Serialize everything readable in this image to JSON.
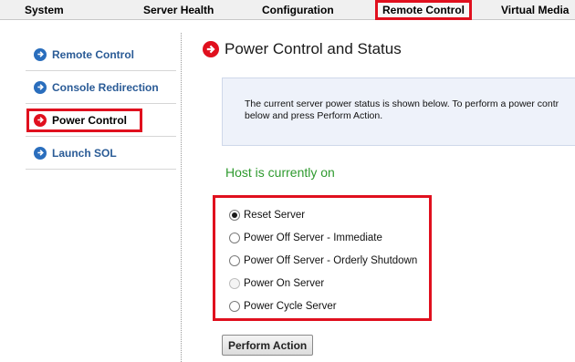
{
  "topnav": {
    "tabs": [
      {
        "label": "System"
      },
      {
        "label": "Server Health"
      },
      {
        "label": "Configuration"
      },
      {
        "label": "Remote Control"
      },
      {
        "label": "Virtual Media"
      }
    ],
    "active": "Remote Control"
  },
  "sidebar": {
    "items": [
      {
        "label": "Remote Control",
        "icon": "arrow-right-circle-icon"
      },
      {
        "label": "Console Redirection",
        "icon": "arrow-right-circle-icon"
      },
      {
        "label": "Power Control",
        "icon": "arrow-right-circle-icon"
      },
      {
        "label": "Launch SOL",
        "icon": "arrow-right-circle-icon"
      }
    ],
    "active": "Power Control"
  },
  "main": {
    "title": "Power Control and Status",
    "info_line1": "The current server power status is shown below. To perform a power contr",
    "info_line2": "below and press Perform Action.",
    "status": "Host is currently on",
    "options": [
      {
        "label": "Reset Server",
        "checked": true,
        "disabled": false
      },
      {
        "label": "Power Off Server - Immediate",
        "checked": false,
        "disabled": false
      },
      {
        "label": "Power Off Server - Orderly Shutdown",
        "checked": false,
        "disabled": false
      },
      {
        "label": "Power On Server",
        "checked": false,
        "disabled": true
      },
      {
        "label": "Power Cycle Server",
        "checked": false,
        "disabled": false
      }
    ],
    "perform_button": "Perform Action"
  },
  "colors": {
    "highlight": "#e0101e",
    "link_blue": "#2a5b96",
    "status_green": "#2e9a2e",
    "info_bg": "#eef2fa"
  }
}
